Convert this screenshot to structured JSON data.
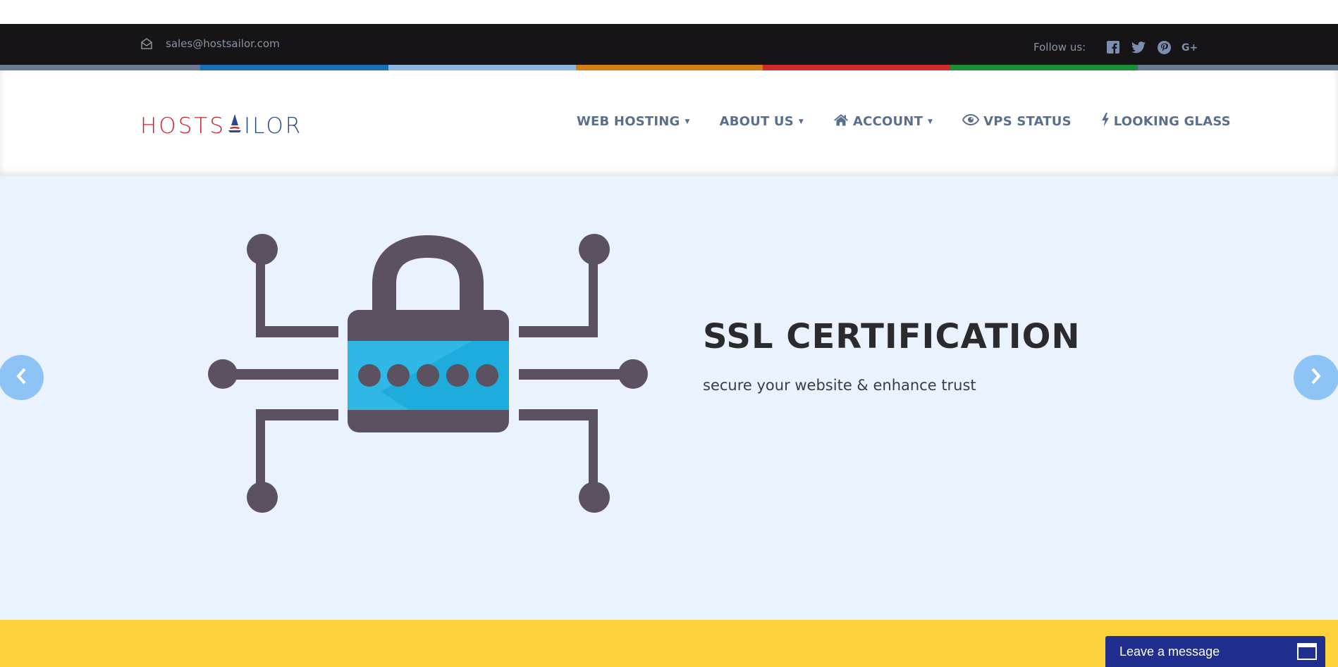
{
  "topbar": {
    "email": "sales@hostsailor.com",
    "email_icon": "envelope-icon",
    "follow_label": "Follow us:",
    "social": [
      "facebook-icon",
      "twitter-icon",
      "pinterest-icon",
      "google-plus-icon"
    ]
  },
  "strip_colors": [
    "#6b7a93",
    "#1b6fb8",
    "#8eb5de",
    "#d27e15",
    "#cf2b2b",
    "#1a8c3a",
    "#6b7a93"
  ],
  "logo": {
    "part1": "HOSTS",
    "part2": "ILOR"
  },
  "nav": {
    "web_hosting": "WEB HOSTING",
    "about_us": "ABOUT US",
    "account": "ACCOUNT",
    "vps_status": "VPS STATUS",
    "looking_glass": "LOOKING GLASS"
  },
  "hero": {
    "title": "SSL CERTIFICATION",
    "subtitle": "secure your website & enhance trust"
  },
  "chat": {
    "label": "Leave a message"
  },
  "colors": {
    "topbar": "#161416",
    "hero_bg": "#eaf3fd",
    "yellow": "#fdd139",
    "chat": "#1f2e8f",
    "nav": "#5a6f8c"
  }
}
